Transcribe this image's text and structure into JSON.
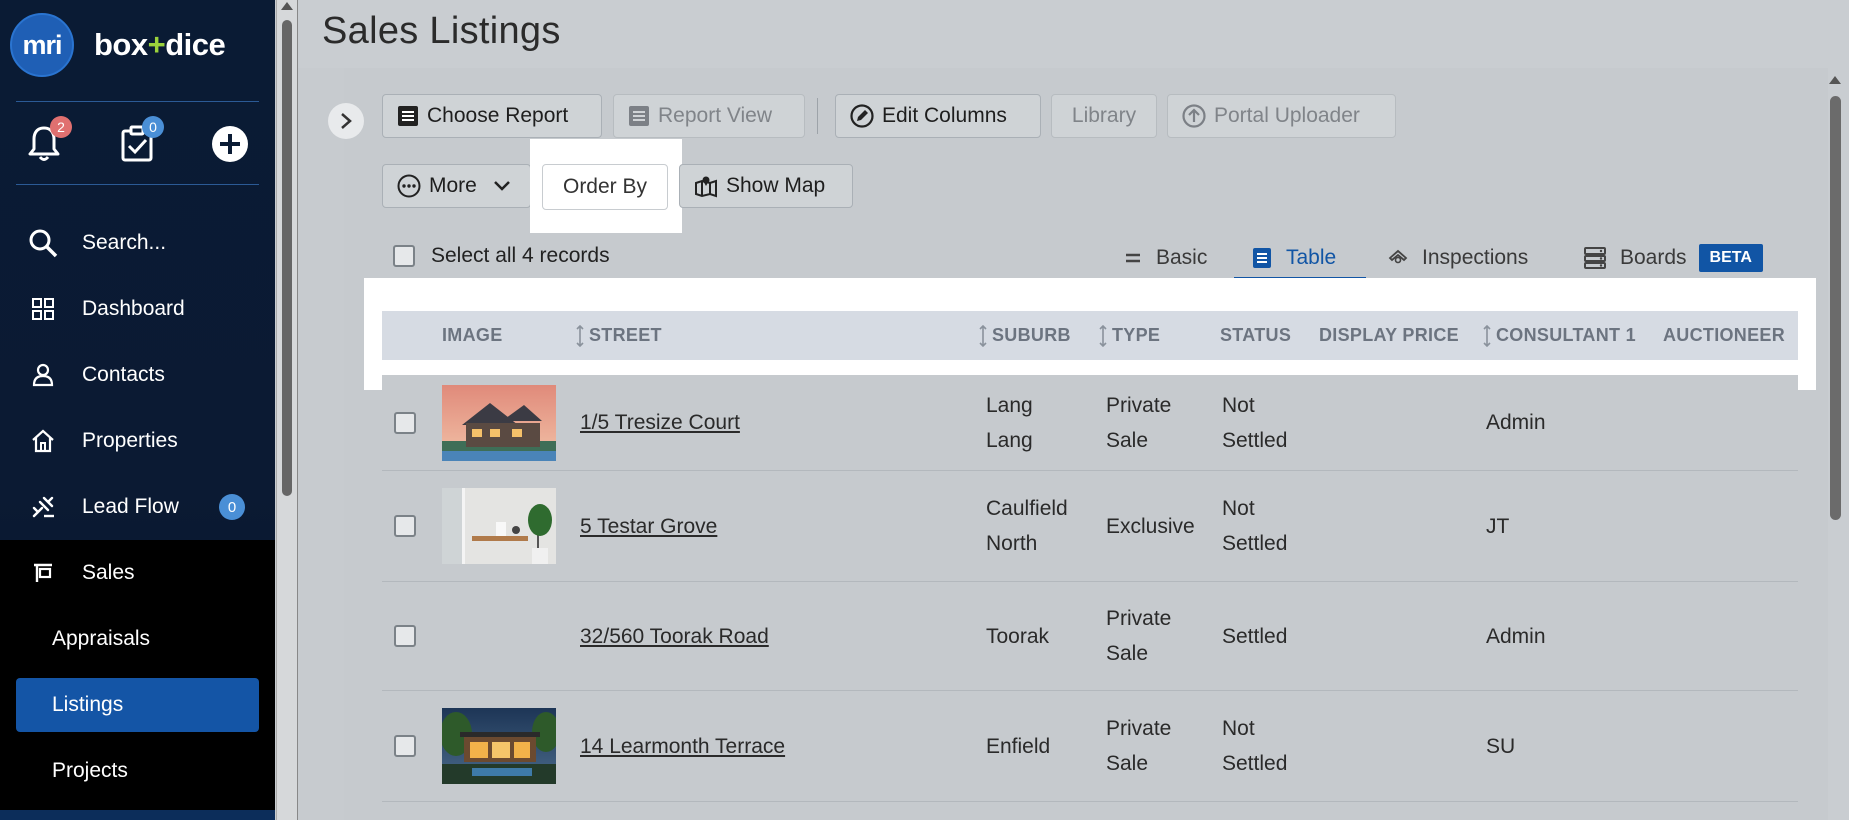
{
  "app": {
    "logo_text": "mri",
    "brand_part1": "box",
    "brand_plus": "+",
    "brand_part2": "dice"
  },
  "quick_actions": {
    "notifications_count": "2",
    "tasks_count": "0"
  },
  "nav": {
    "search": "Search...",
    "dashboard": "Dashboard",
    "contacts": "Contacts",
    "properties": "Properties",
    "lead_flow": "Lead Flow",
    "lead_flow_count": "0",
    "sales": "Sales",
    "sub": {
      "appraisals": "Appraisals",
      "listings": "Listings",
      "projects": "Projects"
    }
  },
  "page": {
    "title": "Sales Listings"
  },
  "toolbar": {
    "choose_report": "Choose Report",
    "report_view": "Report View",
    "edit_columns": "Edit Columns",
    "library": "Library",
    "portal_uploader": "Portal Uploader",
    "more": "More",
    "order_by": "Order By",
    "show_map": "Show Map"
  },
  "select_all": "Select all 4 records",
  "views": {
    "basic": "Basic",
    "table": "Table",
    "inspections": "Inspections",
    "boards": "Boards",
    "beta": "BETA"
  },
  "table": {
    "columns": {
      "image": "IMAGE",
      "street": "STREET",
      "suburb": "SUBURB",
      "type": "TYPE",
      "status": "STATUS",
      "display_price": "DISPLAY PRICE",
      "consultant1": "CONSULTANT 1",
      "auctioneer": "AUCTIONEER"
    },
    "rows": [
      {
        "street": "1/5 Tresize Court",
        "suburb_l1": "Lang",
        "suburb_l2": "Lang",
        "type_l1": "Private",
        "type_l2": "Sale",
        "status_l1": "Not",
        "status_l2": "Settled",
        "consultant": "Admin"
      },
      {
        "street": "5 Testar Grove",
        "suburb_l1": "Caulfield",
        "suburb_l2": "North",
        "type_l1": "Exclusive",
        "type_l2": "",
        "status_l1": "Not",
        "status_l2": "Settled",
        "consultant": "JT"
      },
      {
        "street": "32/560 Toorak Road",
        "suburb_l1": "Toorak",
        "suburb_l2": "",
        "type_l1": "Private",
        "type_l2": "Sale",
        "status_l1": "Settled",
        "status_l2": "",
        "consultant": "Admin"
      },
      {
        "street": "14 Learmonth Terrace",
        "suburb_l1": "Enfield",
        "suburb_l2": "",
        "type_l1": "Private",
        "type_l2": "Sale",
        "status_l1": "Not",
        "status_l2": "Settled",
        "consultant": "SU"
      }
    ]
  },
  "colors": {
    "sidebar_bg": "#0a1b34",
    "accent_blue": "#1155a5",
    "notification_badge": "#e07070",
    "task_badge": "#4a8fd6",
    "brand_plus": "#9bd23c"
  }
}
